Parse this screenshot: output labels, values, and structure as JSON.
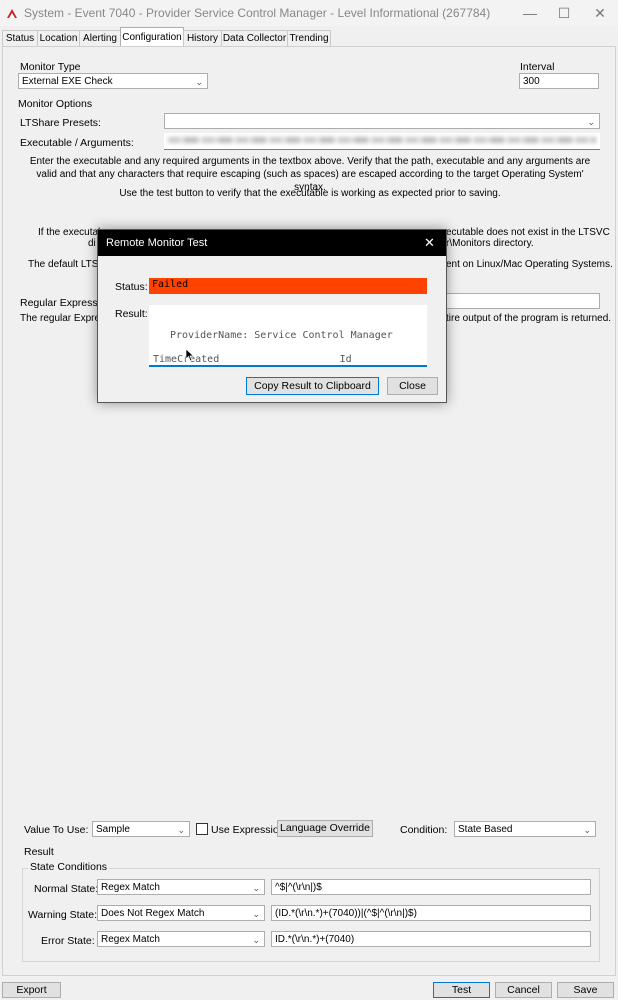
{
  "window": {
    "title": "System - Event 7040 - Provider Service Control Manager - Level Informational (267784)",
    "controls": {
      "minimize": "—",
      "maximize": "☐",
      "close": "✕"
    }
  },
  "tabs": [
    "Status",
    "Location",
    "Alerting",
    "Configuration",
    "History",
    "Data Collector",
    "Trending"
  ],
  "active_tab": "Configuration",
  "config": {
    "monitor_type_label": "Monitor Type",
    "monitor_type_value": "External EXE Check",
    "interval_label": "Interval",
    "interval_value": "300",
    "monitor_options_label": "Monitor Options",
    "ltshare_label": "LTShare Presets:",
    "ltshare_value": "",
    "exe_label": "Executable / Arguments:",
    "help1": "Enter the executable and any required arguments in the textbox above. Verify that the path, executable and any arguments are valid and that any characters that require escaping (such as spaces) are escaped according to the target Operating System' syntax.",
    "help2": "Use the test button to verify that the executable is working as expected prior to saving.",
    "help3_left": "If the executab",
    "help3_left2": "di",
    "help3_right": "ecutable does not exist in the LTSVC",
    "help3_right2": "r\\Monitors directory.",
    "help4_left": "The default LTSV",
    "help4_right": "ent on Linux/Mac Operating Systems.",
    "regex_label": "Regular Expression",
    "regex_help_left": "The regular Express",
    "regex_help_right": "tire output of the program is returned."
  },
  "dialog": {
    "title": "Remote Monitor Test",
    "status_label": "Status:",
    "status_value": "Failed",
    "result_label": "Result:",
    "result_line1": "ProviderName: Service Control Manager",
    "result_line2": "TimeCreated                    Id",
    "copy_button": "Copy Result to Clipboard",
    "close_button": "Close"
  },
  "lower": {
    "value_to_use_label": "Value To Use:",
    "value_to_use_value": "Sample",
    "use_expression_label": "Use Expression",
    "language_override_button": "Language Override",
    "condition_label": "Condition:",
    "condition_value": "State Based",
    "result_label": "Result",
    "state_conditions_label": "State Conditions",
    "states": [
      {
        "label": "Normal State:",
        "type": "Regex Match",
        "value": "^$|^(\\r\\n|)$"
      },
      {
        "label": "Warning State:",
        "type": "Does Not Regex Match",
        "value": "(ID.*(\\r\\n.*)+(7040))|(^$|^(\\r\\n|)$)"
      },
      {
        "label": "Error State:",
        "type": "Regex Match",
        "value": "ID.*(\\r\\n.*)+(7040)"
      }
    ]
  },
  "bottom": {
    "export": "Export",
    "test": "Test",
    "cancel": "Cancel",
    "save": "Save"
  }
}
